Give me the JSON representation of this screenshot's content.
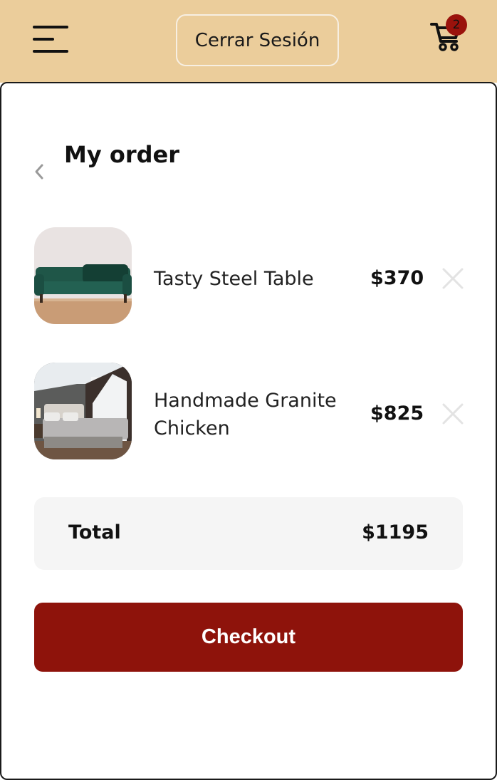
{
  "header": {
    "menu_icon": "hamburger-menu-icon",
    "logout_label": "Cerrar Sesión",
    "cart_icon": "shopping-cart-icon",
    "cart_count": "2",
    "background_color": "#ebcd9b",
    "badge_color": "#9a120c"
  },
  "order": {
    "back_icon": "chevron-left-icon",
    "title": "My order",
    "items": [
      {
        "name": "Tasty Steel Table",
        "price": "$370",
        "image": "green-sofa-photo",
        "remove_icon": "close-icon"
      },
      {
        "name": "Handmade Granite Chicken",
        "price": "$825",
        "image": "bedroom-photo",
        "remove_icon": "close-icon"
      }
    ],
    "total_label": "Total",
    "total_value": "$1195",
    "checkout_label": "Checkout",
    "checkout_color": "#8e130b"
  }
}
